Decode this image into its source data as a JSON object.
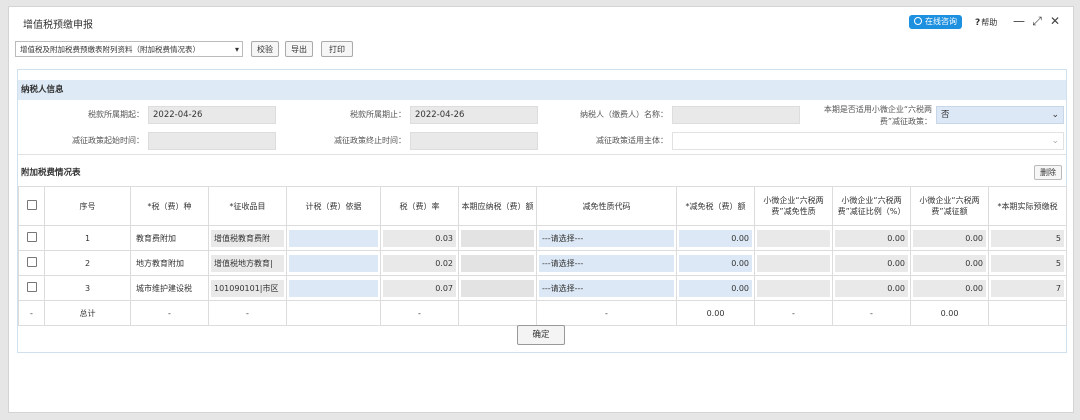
{
  "window": {
    "title": "增值税预缴申报",
    "online_help": "在线咨询",
    "help": "帮助",
    "help_icon": "?",
    "icons": [
      "minimize-icon",
      "maximize-icon",
      "close-icon"
    ]
  },
  "toolbar": {
    "form_select": "增值税及附加税费预缴表附列资料（附加税费情况表）",
    "validate": "校验",
    "export": "导出",
    "print": "打印"
  },
  "taxpayer": {
    "section_title": "纳税人信息",
    "period_start_label": "税款所属期起：",
    "period_start": "2022-04-26",
    "period_end_label": "税款所属期止：",
    "period_end": "2022-04-26",
    "name_label": "纳税人（缴费人）名称：",
    "name": "",
    "six_tax_label": "本期是否适用小微企业“六税两费”减征政策：",
    "six_tax_value": "否",
    "policy_start_label": "减征政策起始时间：",
    "policy_start": "",
    "policy_end_label": "减征政策终止时间：",
    "policy_end": "",
    "policy_subject_label": "减征政策适用主体：",
    "policy_subject": ""
  },
  "surcharge": {
    "section_title": "附加税费情况表",
    "delete_label": "删除",
    "headers": [
      "序号",
      "*税（费）种",
      "*征收品目",
      "计税（费）依据",
      "税（费）率",
      "本期应纳税（费）额",
      "减免性质代码",
      "*减免税（费）额",
      "小微企业“六税两费”减免性质",
      "小微企业“六税两费”减征比例（%）",
      "小微企业“六税两费”减征额",
      "*本期实际预缴税"
    ],
    "rows": [
      {
        "no": "1",
        "type": "教育费附加",
        "item": "增值税教育费附",
        "rate": "0.03",
        "code": "---请选择---",
        "reduce": "0.00",
        "ratio": "0.00",
        "reduced_amt": "0.00",
        "actual": "5"
      },
      {
        "no": "2",
        "type": "地方教育附加",
        "item": "增值税地方教育|",
        "rate": "0.02",
        "code": "---请选择---",
        "reduce": "0.00",
        "ratio": "0.00",
        "reduced_amt": "0.00",
        "actual": "5"
      },
      {
        "no": "3",
        "type": "城市维护建设税",
        "item": "101090101|市区",
        "rate": "0.07",
        "code": "---请选择---",
        "reduce": "0.00",
        "ratio": "0.00",
        "reduced_amt": "0.00",
        "actual": "7"
      }
    ],
    "total": {
      "dash": "-",
      "label": "总计",
      "reduce": "0.00",
      "reduced_amt": "0.00"
    }
  },
  "confirm": "确定"
}
